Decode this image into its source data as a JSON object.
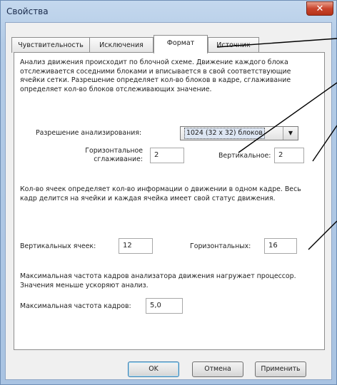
{
  "window": {
    "title": "Свойства",
    "close_glyph": "✕"
  },
  "tabs": [
    {
      "label": "Чувствительность",
      "active": false
    },
    {
      "label": "Исключения",
      "active": false
    },
    {
      "label": "Формат",
      "active": true
    },
    {
      "label": "Источник",
      "active": false
    }
  ],
  "format": {
    "description1": "Анализ движения происходит по блочной схеме. Движение каждого блока отслеживается соседними блоками и вписывается в свой соответствующие ячейки сетки. Разрешение определяет кол-во блоков в кадре, сглаживание определяет кол-во блоков отслеживающих значение.",
    "resolution_label": "Разрешение анализирования:",
    "resolution_value": "1024 (32 x 32) блоков",
    "h_smoothing_label": "Горизонтальное\nсглаживание:",
    "h_smoothing_value": "2",
    "v_label": "Вертикальное:",
    "v_value": "2",
    "description2": "Кол-во ячеек определяет кол-во информации о движении в одном кадре. Весь кадр делится на ячейки и каждая ячейка имеет свой статус движения.",
    "v_cells_label": "Вертикальных ячеек:",
    "v_cells_value": "12",
    "h_cells_label": "Горизонтальных:",
    "h_cells_value": "16",
    "description3": "Максимальная частота кадров анализатора движения нагружает процессор. Значения меньше ускоряют анализ.",
    "max_fps_label": "Максимальная частота кадров:",
    "max_fps_value": "5,0"
  },
  "buttons": {
    "ok": "OK",
    "cancel": "Отмена",
    "apply": "Применить"
  },
  "colors": {
    "titlebar": "#b3cbe6",
    "close": "#c9452d",
    "callout_line": "#000000"
  }
}
